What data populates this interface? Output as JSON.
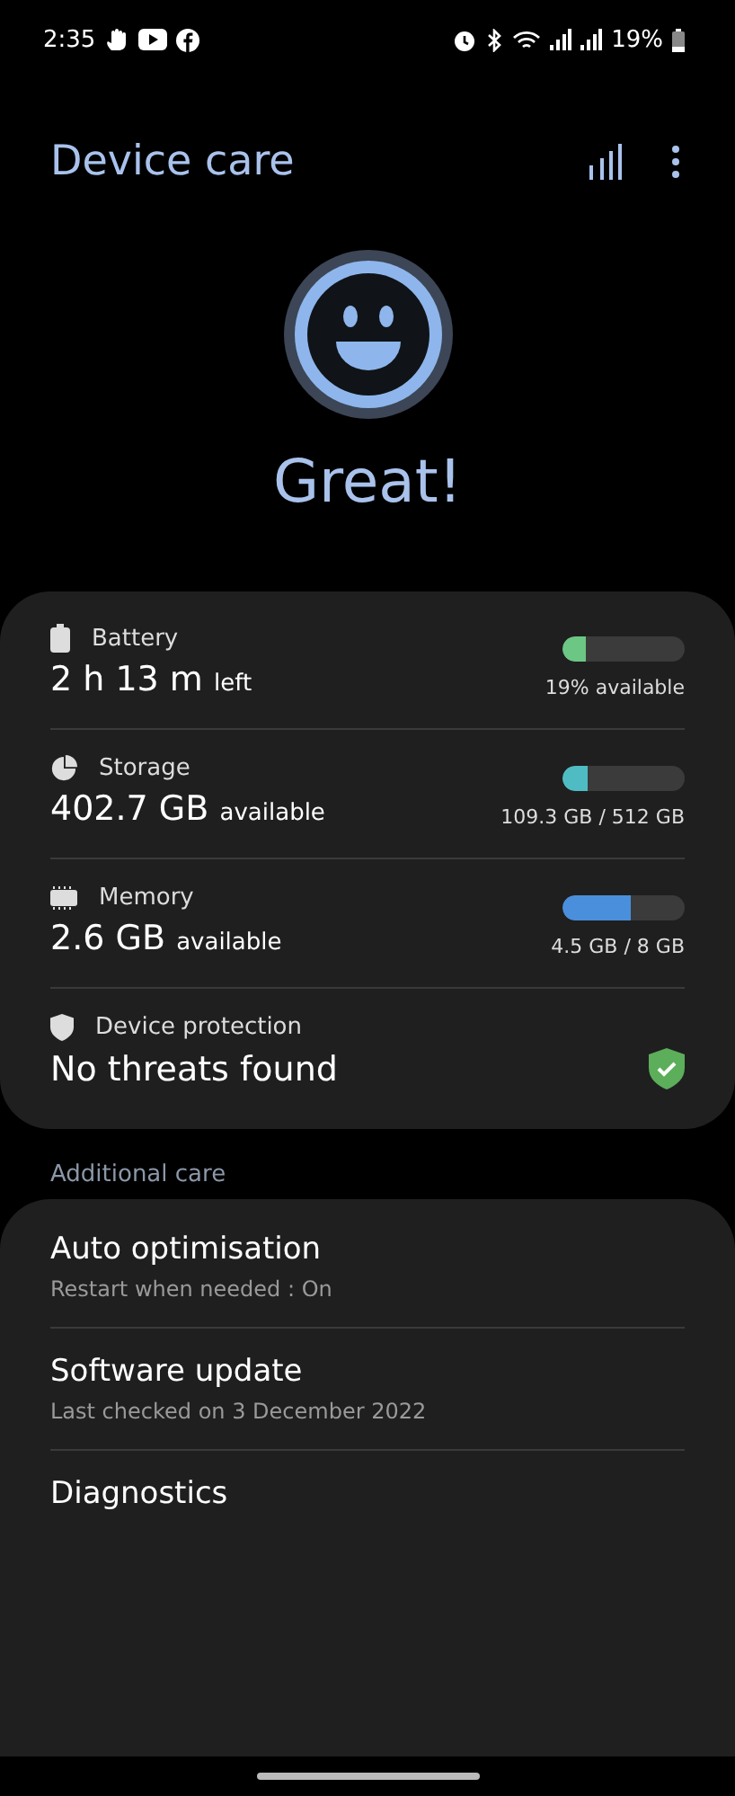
{
  "status_bar": {
    "time": "2:35",
    "battery": "19%"
  },
  "header": {
    "title": "Device care"
  },
  "status": {
    "label": "Great!"
  },
  "summary": [
    {
      "kind": "meter",
      "label": "Battery",
      "value": "2 h 13 m",
      "unit": "left",
      "level": 0.19,
      "color": "#6cc684",
      "reading": "19% available"
    },
    {
      "kind": "meter",
      "label": "Storage",
      "value": "402.7 GB",
      "unit": "available",
      "level": 0.21,
      "color": "#4fbcc4",
      "reading": "109.3 GB / 512 GB"
    },
    {
      "kind": "meter",
      "label": "Memory",
      "value": "2.6 GB",
      "unit": "available",
      "level": 0.56,
      "color": "#4a8fdc",
      "reading": "4.5 GB / 8 GB"
    },
    {
      "kind": "protection",
      "label": "Device protection",
      "value": "No threats found"
    }
  ],
  "additional_care": {
    "heading": "Additional care",
    "items": [
      {
        "title": "Auto optimisation",
        "subtitle": "Restart when needed : On"
      },
      {
        "title": "Software update",
        "subtitle": "Last checked on 3 December 2022"
      },
      {
        "title": "Diagnostics"
      }
    ]
  }
}
